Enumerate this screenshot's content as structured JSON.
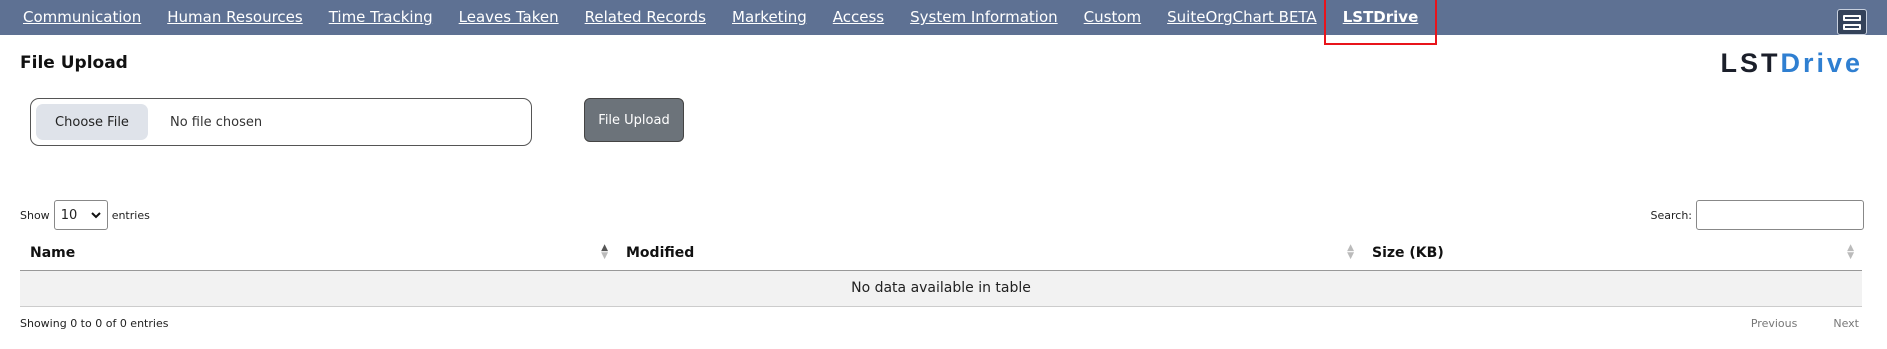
{
  "nav": {
    "items": [
      {
        "label": "Communication"
      },
      {
        "label": "Human Resources"
      },
      {
        "label": "Time Tracking"
      },
      {
        "label": "Leaves Taken"
      },
      {
        "label": "Related Records"
      },
      {
        "label": "Marketing"
      },
      {
        "label": "Access"
      },
      {
        "label": "System Information"
      },
      {
        "label": "Custom"
      },
      {
        "label": "SuiteOrgChart BETA"
      },
      {
        "label": "LSTDrive",
        "active": true
      }
    ]
  },
  "page": {
    "title": "File Upload",
    "logo_part1": "LST",
    "logo_part2": "Drive"
  },
  "upload": {
    "choose_label": "Choose File",
    "file_status": "No file chosen",
    "button_label": "File Upload"
  },
  "table_controls": {
    "show_label": "Show",
    "page_length": "10",
    "entries_label": "entries",
    "search_label": "Search:"
  },
  "table": {
    "columns": [
      {
        "label": "Name"
      },
      {
        "label": "Modified"
      },
      {
        "label": "Size (KB)"
      }
    ],
    "empty_message": "No data available in table"
  },
  "footer": {
    "info": "Showing 0 to 0 of 0 entries",
    "prev_label": "Previous",
    "next_label": "Next"
  },
  "colors": {
    "nav_bg": "#5e7193",
    "highlight": "#e8141b",
    "logo_blue": "#2f7fd1"
  }
}
